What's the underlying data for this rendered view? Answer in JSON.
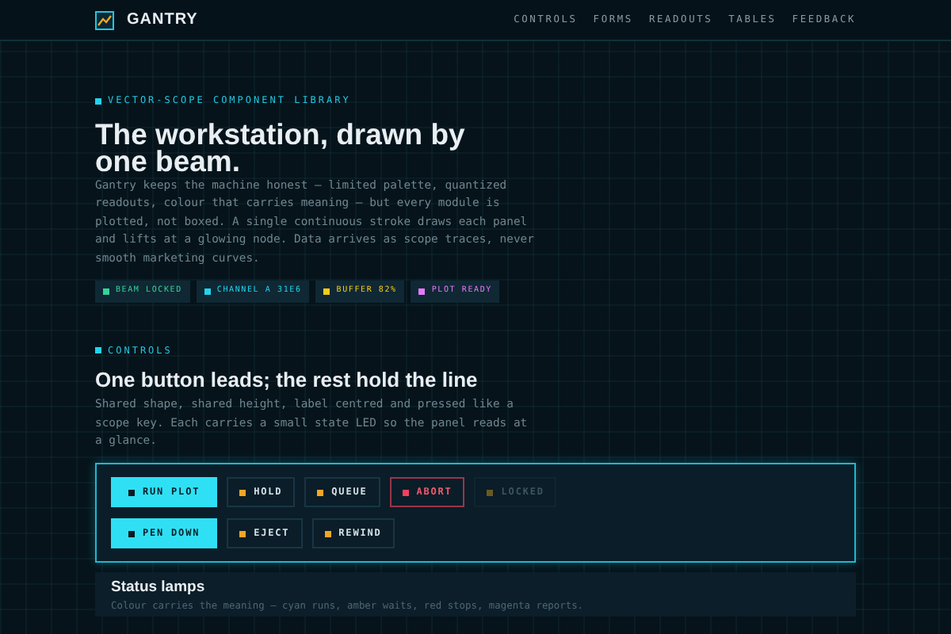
{
  "brand": {
    "name": "GANTRY"
  },
  "nav": [
    {
      "label": "CONTROLS"
    },
    {
      "label": "FORMS"
    },
    {
      "label": "READOUTS"
    },
    {
      "label": "TABLES"
    },
    {
      "label": "FEEDBACK"
    }
  ],
  "hero": {
    "eyebrow": "VECTOR-SCOPE COMPONENT LIBRARY",
    "title": "The workstation, drawn by one beam.",
    "body": "Gantry keeps the machine honest — limited palette, quantized readouts, colour that carries meaning — but every module is plotted, not boxed. A single continuous stroke draws each panel and lifts at a glowing node. Data arrives as scope traces, never smooth marketing curves.",
    "badges": [
      {
        "label": "BEAM LOCKED",
        "color": "#34d399"
      },
      {
        "label": "CHANNEL A 31E6",
        "color": "#22d3ee"
      },
      {
        "label": "BUFFER 82%",
        "color": "#facc15"
      },
      {
        "label": "PLOT READY",
        "color": "#e879f9"
      }
    ]
  },
  "controls": {
    "eyebrow": "CONTROLS",
    "title": "One button leads; the rest hold the line",
    "body": "Shared shape, shared height, label centred and pressed like a scope key. Each carries a small state LED so the panel reads at a glance.",
    "button_rows": [
      [
        {
          "label": "RUN PLOT",
          "kind": "primary",
          "color": "#0b1a22"
        },
        {
          "label": "HOLD",
          "kind": "default",
          "color": "#f5a524"
        },
        {
          "label": "QUEUE",
          "kind": "default",
          "color": "#f5a524"
        },
        {
          "label": "ABORT",
          "kind": "danger",
          "color": "#f43f5e"
        },
        {
          "label": "LOCKED",
          "kind": "disabled",
          "color": "#6b5a1e"
        }
      ],
      [
        {
          "label": "PEN DOWN",
          "kind": "primary",
          "color": "#0b1a22"
        },
        {
          "label": "EJECT",
          "kind": "default",
          "color": "#f5a524"
        },
        {
          "label": "REWIND",
          "kind": "default",
          "color": "#f5a524"
        }
      ]
    ]
  },
  "status_lamps": {
    "title": "Status lamps",
    "body": "Colour carries the meaning — cyan runs, amber waits, red stops, magenta reports."
  }
}
